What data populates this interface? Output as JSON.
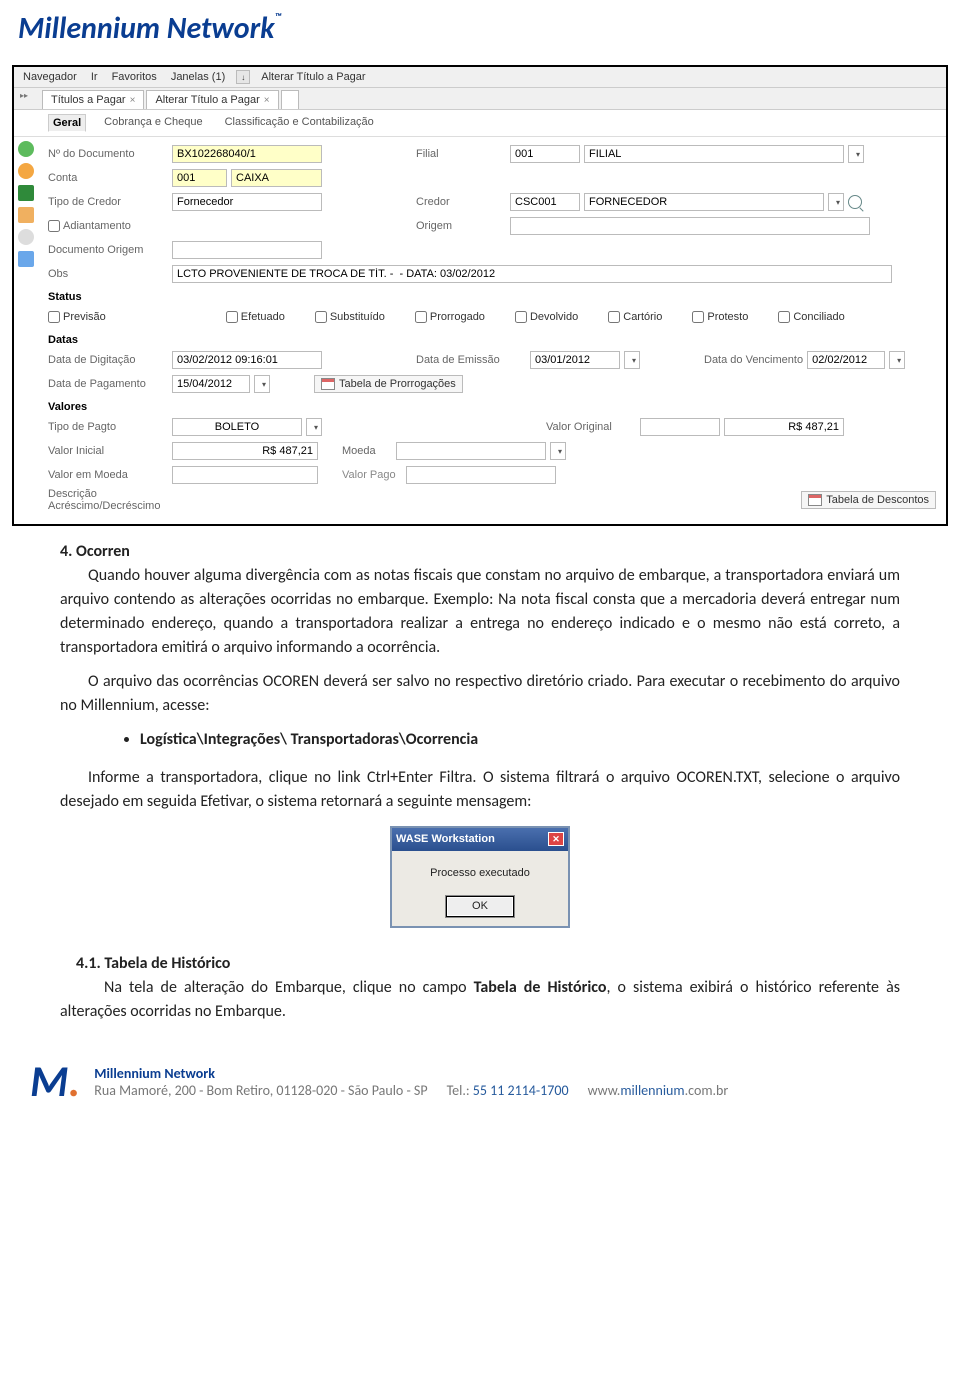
{
  "brand": "Millennium Network",
  "screenshot": {
    "menubar": {
      "navegador": "Navegador",
      "ir": "Ir",
      "favoritos": "Favoritos",
      "janelas": "Janelas (1)",
      "alterar": "Alterar Título a Pagar"
    },
    "tabs": {
      "tab1": "Títulos a Pagar",
      "tab2": "Alterar Título a Pagar"
    },
    "subtabs": {
      "geral": "Geral",
      "cobranca": "Cobrança e Cheque",
      "class": "Classificação e Contabilização"
    },
    "fields": {
      "num_doc_lbl": "Nº do Documento",
      "num_doc_val": "BX102268040/1",
      "filial_lbl": "Filial",
      "filial_code": "001",
      "filial_name": "FILIAL",
      "conta_lbl": "Conta",
      "conta_code": "001",
      "conta_name": "CAIXA",
      "tipo_credor_lbl": "Tipo de Credor",
      "tipo_credor_val": "Fornecedor",
      "credor_lbl": "Credor",
      "credor_code": "CSC001",
      "credor_name": "FORNECEDOR",
      "adiant_lbl": "Adiantamento",
      "origem_lbl": "Origem",
      "doc_origem_lbl": "Documento Origem",
      "obs_lbl": "Obs",
      "obs_val": "LCTO PROVENIENTE DE TROCA DE TÍT. -  - DATA: 03/02/2012",
      "status_h": "Status",
      "status": {
        "previsao": "Previsão",
        "efetuado": "Efetuado",
        "substituido": "Substituído",
        "prorrogado": "Prorrogado",
        "devolvido": "Devolvido",
        "cartorio": "Cartório",
        "protesto": "Protesto",
        "conciliado": "Conciliado"
      },
      "datas_h": "Datas",
      "data_digit_lbl": "Data de Digitação",
      "data_digit_val": "03/02/2012 09:16:01",
      "data_emiss_lbl": "Data de Emissão",
      "data_emiss_val": "03/01/2012",
      "data_venc_lbl": "Data do Vencimento",
      "data_venc_val": "02/02/2012",
      "data_pag_lbl": "Data de Pagamento",
      "data_pag_val": "15/04/2012",
      "tab_prorr": "Tabela de Prorrogações",
      "valores_h": "Valores",
      "tipo_pagto_lbl": "Tipo de Pagto",
      "tipo_pagto_val": "BOLETO",
      "valor_orig_lbl": "Valor Original",
      "valor_orig_val": "R$ 487,21",
      "valor_inicial_lbl": "Valor Inicial",
      "valor_inicial_val": "R$ 487,21",
      "moeda_lbl": "Moeda",
      "valor_moeda_lbl": "Valor em Moeda",
      "valor_pago_lbl": "Valor Pago",
      "descr_lbl": "Descrição\nAcréscimo/Decréscimo",
      "tab_desc": "Tabela de Descontos"
    }
  },
  "body": {
    "h1": "4. Ocorren",
    "p1": "Quando houver alguma divergência com as notas fiscais que constam no arquivo de embarque, a transportadora enviará um arquivo contendo as alterações ocorridas no embarque. Exemplo: Na nota fiscal consta que a mercadoria deverá entregar num determinado endereço, quando a transportadora realizar a entrega no endereço indicado e o mesmo não está correto, a transportadora emitirá o arquivo informando a ocorrência.",
    "p2": "O arquivo das ocorrências OCOREN deverá ser salvo no respectivo diretório criado. Para executar o recebimento do arquivo no Millennium, acesse:",
    "bullet": "Logística\\Integrações\\ Transportadoras\\Ocorrencia",
    "p3": "Informe a transportadora, clique no link Ctrl+Enter Filtra. O sistema filtrará o arquivo OCOREN.TXT, selecione o arquivo desejado em seguida Efetivar, o sistema retornará a seguinte mensagem:",
    "dlg_title": "WASE Workstation",
    "dlg_msg": "Processo executado",
    "dlg_ok": "OK",
    "h2": "4.1. Tabela de Histórico",
    "p4a": "Na tela de alteração do Embarque, clique no campo ",
    "p4b": "Tabela de Histórico",
    "p4c": ", o sistema exibirá o histórico referente às alterações ocorridas no Embarque."
  },
  "footer": {
    "company": "Millennium Network",
    "addr": "Rua Mamoré, 200 - Bom Retiro, 01128-020 - São Paulo - SP",
    "tel_lbl": "Tel.: ",
    "tel_val": "55 11 2114-1700",
    "site_pre": "www.",
    "site_mid": "millennium",
    "site_suf": ".com.br"
  }
}
